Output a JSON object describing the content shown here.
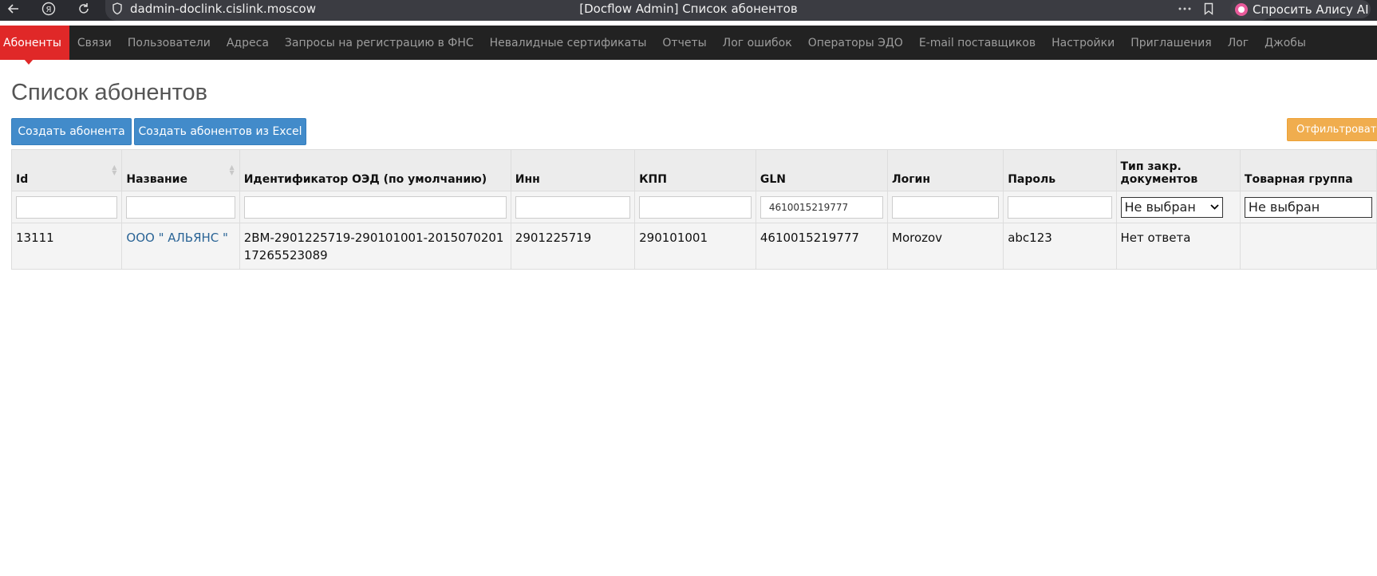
{
  "browser": {
    "url": "dadmin-doclink.cislink.moscow",
    "tab_title": "[Docflow Admin] Список абонентов",
    "alice_label": "Спросить Алису AI",
    "icons": [
      "back-arrow-icon",
      "yandex-icon",
      "reload-icon",
      "shield-icon",
      "more-dots-icon",
      "bookmark-icon",
      "alice-icon"
    ]
  },
  "navbar": {
    "items": [
      {
        "label": "Абоненты",
        "active": true
      },
      {
        "label": "Связи"
      },
      {
        "label": "Пользователи"
      },
      {
        "label": "Адреса"
      },
      {
        "label": "Запросы на регистрацию в ФНС"
      },
      {
        "label": "Невалидные сертификаты"
      },
      {
        "label": "Отчеты"
      },
      {
        "label": "Лог ошибок"
      },
      {
        "label": "Операторы ЭДО"
      },
      {
        "label": "E-mail поставщиков"
      },
      {
        "label": "Настройки"
      },
      {
        "label": "Приглашения"
      },
      {
        "label": "Лог"
      },
      {
        "label": "Джобы"
      }
    ]
  },
  "page": {
    "title": "Список абонентов",
    "create_button": "Создать абонента",
    "create_excel_button": "Создать абонентов из Excel",
    "filter_button": "Отфильтровать"
  },
  "table": {
    "columns": [
      "Id",
      "Название",
      "Идентификатор ОЭД (по умолчанию)",
      "Инн",
      "КПП",
      "GLN",
      "Логин",
      "Пароль",
      "Тип закр. документов",
      "Товарная группа"
    ],
    "filters": {
      "id": "",
      "name": "",
      "edo_id": "",
      "inn": "",
      "kpp": "",
      "gln": "4610015219777",
      "login": "",
      "password": "",
      "doc_type": "Не выбран",
      "product_group": "Не выбран"
    },
    "rows": [
      {
        "id": "13111",
        "name": "ООО \" АЛЬЯНС \"",
        "edo_id": "2BM-2901225719-290101001-20150702011726552308​9",
        "inn": "2901225719",
        "kpp": "290101001",
        "gln": "4610015219777",
        "login": "Morozov",
        "password": "abc123",
        "doc_type": "Нет ответа",
        "product_group": ""
      }
    ]
  }
}
